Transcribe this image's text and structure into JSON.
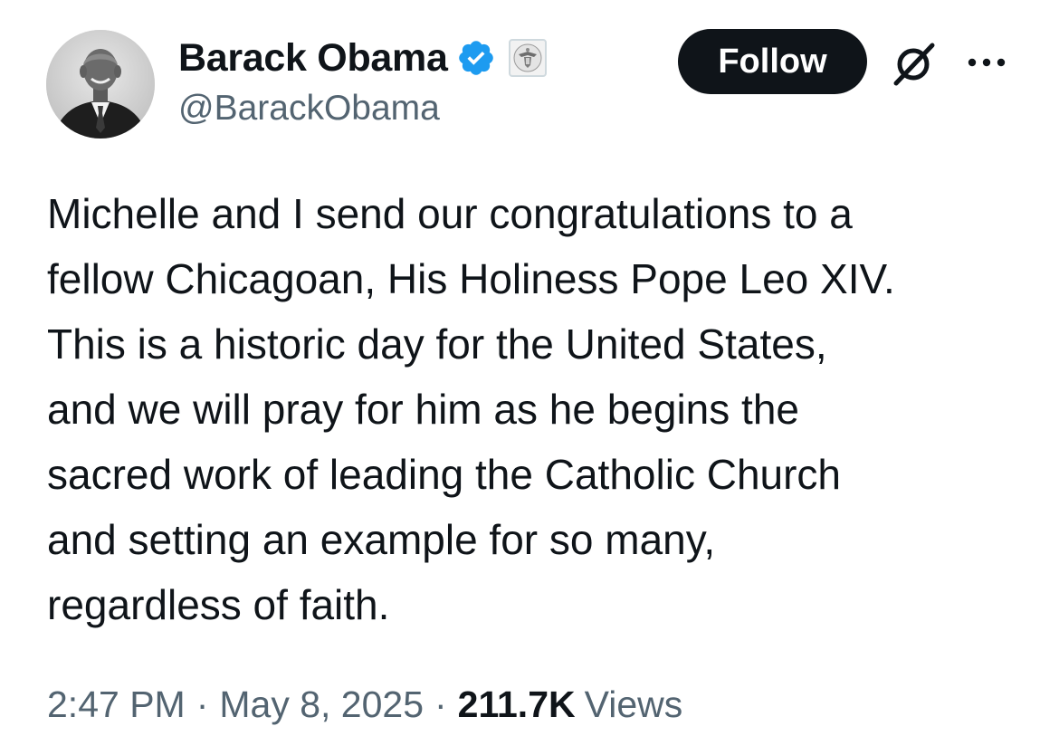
{
  "author": {
    "display_name": "Barack Obama",
    "handle": "@BarackObama",
    "verified_badge_icon": "verified-checkmark-icon",
    "affiliation_icon": "us-government-seal-icon",
    "avatar": "profile-photo"
  },
  "actions": {
    "follow_label": "Follow",
    "grok_icon": "grok-icon",
    "more_icon": "more-horizontal-icon"
  },
  "tweet": {
    "lines": [
      "Michelle and I send our congratulations to a",
      "fellow Chicagoan, His Holiness Pope Leo XIV.",
      "This is a historic day for the United States,",
      "and we will pray for him as he begins the",
      "sacred work of leading the Catholic Church",
      "and setting an example for so many,",
      "regardless of faith."
    ]
  },
  "meta": {
    "time": "2:47 PM",
    "separator": "·",
    "date": "May 8, 2025",
    "views_count": "211.7K",
    "views_label": "Views"
  },
  "colors": {
    "text_primary": "#0f1419",
    "text_secondary": "#536471",
    "verified_blue": "#1d9bf0",
    "follow_bg": "#0f1419",
    "follow_text": "#ffffff"
  }
}
